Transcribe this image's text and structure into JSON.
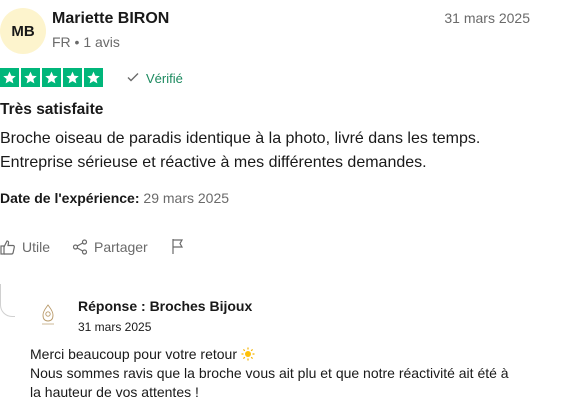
{
  "reviewer": {
    "initials": "MB",
    "name": "Mariette BIRON",
    "meta": "FR • 1 avis",
    "date": "31 mars 2025"
  },
  "rating": {
    "stars": 5,
    "max": 5,
    "color": "#00b67a"
  },
  "verified_label": "Vérifié",
  "review": {
    "title": "Très satisfaite",
    "body_line1": "Broche oiseau de paradis identique à la photo, livré dans les temps.",
    "body_line2": "Entreprise sérieuse et réactive à mes différentes demandes."
  },
  "experience": {
    "label": "Date de l'expérience:",
    "date": "29 mars 2025"
  },
  "actions": {
    "useful": "Utile",
    "share": "Partager"
  },
  "reply": {
    "title": "Réponse : Broches Bijoux",
    "date": "31 mars 2025",
    "line1": "Merci beaucoup pour votre retour ",
    "line2": "Nous sommes ravis que la broche vous ait plu et que notre réactivité ait été à",
    "line3": "la hauteur de vos attentes !"
  },
  "icons": {
    "star": "star-icon",
    "verified": "check-icon",
    "useful": "thumbs-up-icon",
    "share": "share-icon",
    "flag": "flag-icon",
    "sun": "sun-emoji-icon",
    "logo": "company-logo"
  }
}
